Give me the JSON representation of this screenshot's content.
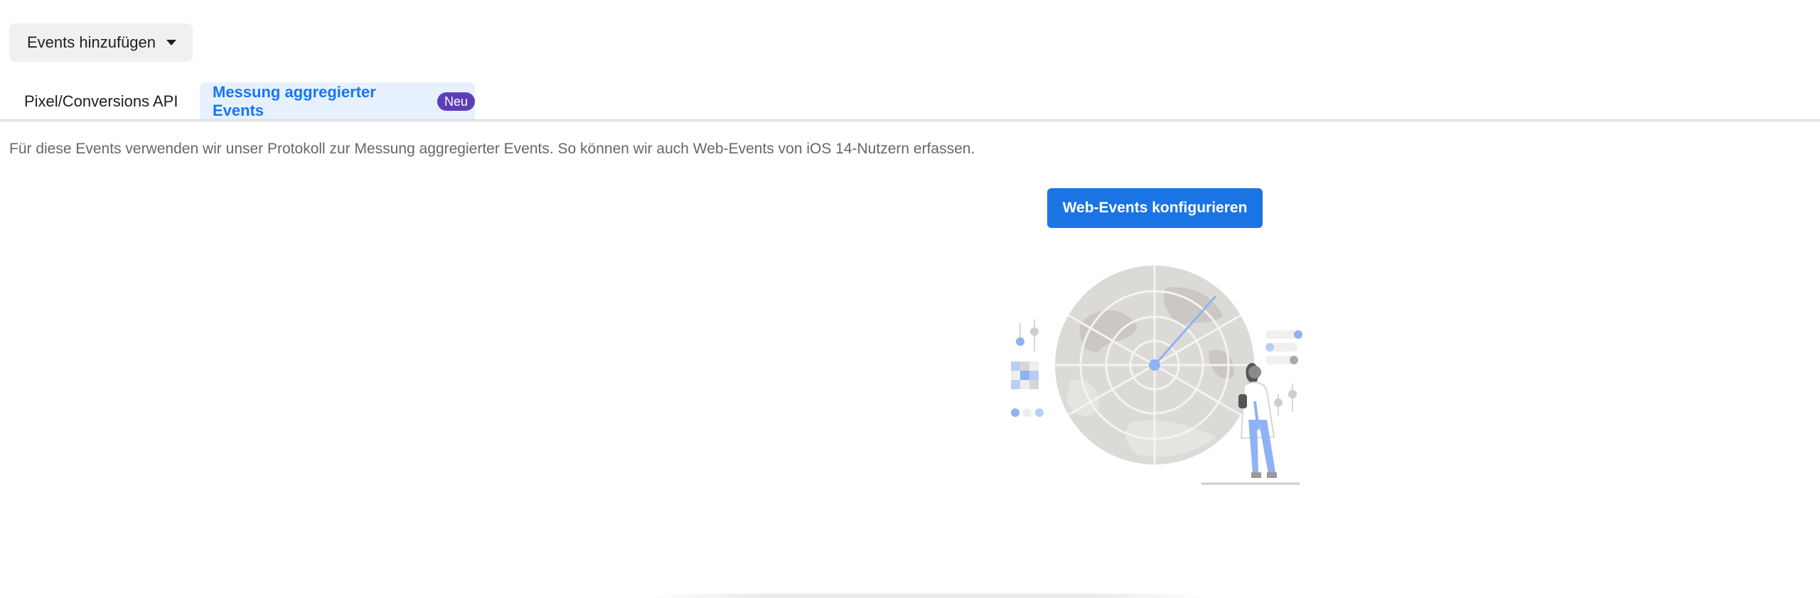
{
  "toolbar": {
    "add_events_label": "Events hinzufügen",
    "add_events_icon": "chevron-down-icon"
  },
  "tabs": [
    {
      "label": "Pixel/Conversions API",
      "active": false
    },
    {
      "label": "Messung aggregierter Events",
      "active": true,
      "badge": "Neu"
    }
  ],
  "main": {
    "description": "Für diese Events verwenden wir unser Protokoll zur Messung aggregierter Events. So können wir auch Web-Events von iOS 14-Nutzern erfassen.",
    "configure_button_label": "Web-Events konfigurieren",
    "illustration": "radar-illustration"
  },
  "colors": {
    "accent": "#1b74e4",
    "tab_active_bg": "#e7f0fd",
    "tab_active_text": "#1876f2",
    "badge_bg": "#5b3fb8"
  }
}
